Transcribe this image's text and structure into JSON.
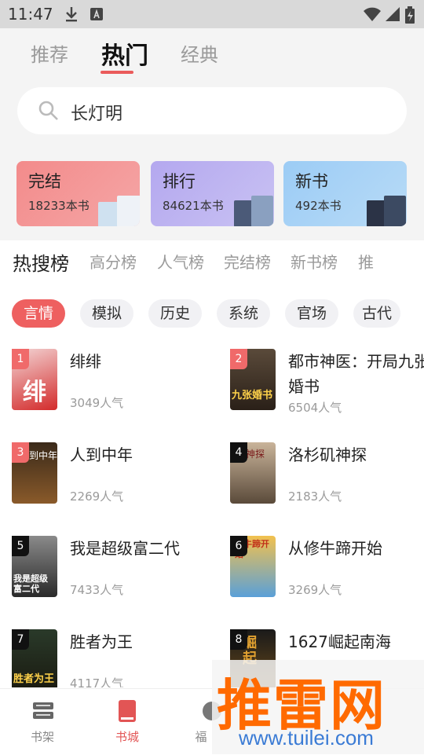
{
  "status_bar": {
    "time": "11:47"
  },
  "top_tabs": [
    {
      "label": "推荐"
    },
    {
      "label": "热门"
    },
    {
      "label": "经典"
    }
  ],
  "search": {
    "value": "长灯明"
  },
  "categories": [
    {
      "title": "完结",
      "count": "18233本书",
      "color": "#f07575"
    },
    {
      "title": "排行",
      "count": "84621本书",
      "color": "#a9a3ee"
    },
    {
      "title": "新书",
      "count": "492本书",
      "color": "#91c6f5"
    }
  ],
  "ranking_tabs": [
    "热搜榜",
    "高分榜",
    "人气榜",
    "完结榜",
    "新书榜",
    "推"
  ],
  "genre_chips": [
    "言情",
    "模拟",
    "历史",
    "系统",
    "官场",
    "古代"
  ],
  "books": [
    {
      "rank": "1",
      "title": "绯绯",
      "popularity": "3049人气",
      "cover_text": "绯"
    },
    {
      "rank": "2",
      "title": "都市神医：开局九张婚书",
      "popularity": "6504人气",
      "cover_text": "九张婚书"
    },
    {
      "rank": "3",
      "title": "人到中年",
      "popularity": "2269人气",
      "cover_text": "人到中年"
    },
    {
      "rank": "4",
      "title": "洛杉矶神探",
      "popularity": "2183人气",
      "cover_text": "神探"
    },
    {
      "rank": "5",
      "title": "我是超级富二代",
      "popularity": "7433人气",
      "cover_text": "我是超级富二代"
    },
    {
      "rank": "6",
      "title": "从修牛蹄开始",
      "popularity": "3269人气",
      "cover_text": "修牛蹄开始"
    },
    {
      "rank": "7",
      "title": "胜者为王",
      "popularity": "4117人气",
      "cover_text": "胜者为王"
    },
    {
      "rank": "8",
      "title": "1627崛起南海",
      "popularity": "",
      "cover_text": "崛起"
    }
  ],
  "bottom_nav": [
    {
      "label": "书架",
      "icon": "bookshelf-icon"
    },
    {
      "label": "书城",
      "icon": "book-icon"
    },
    {
      "label": "福",
      "icon": "welfare-icon"
    }
  ],
  "watermark": {
    "text": "推雷网",
    "url": "www.tuilei.com"
  }
}
